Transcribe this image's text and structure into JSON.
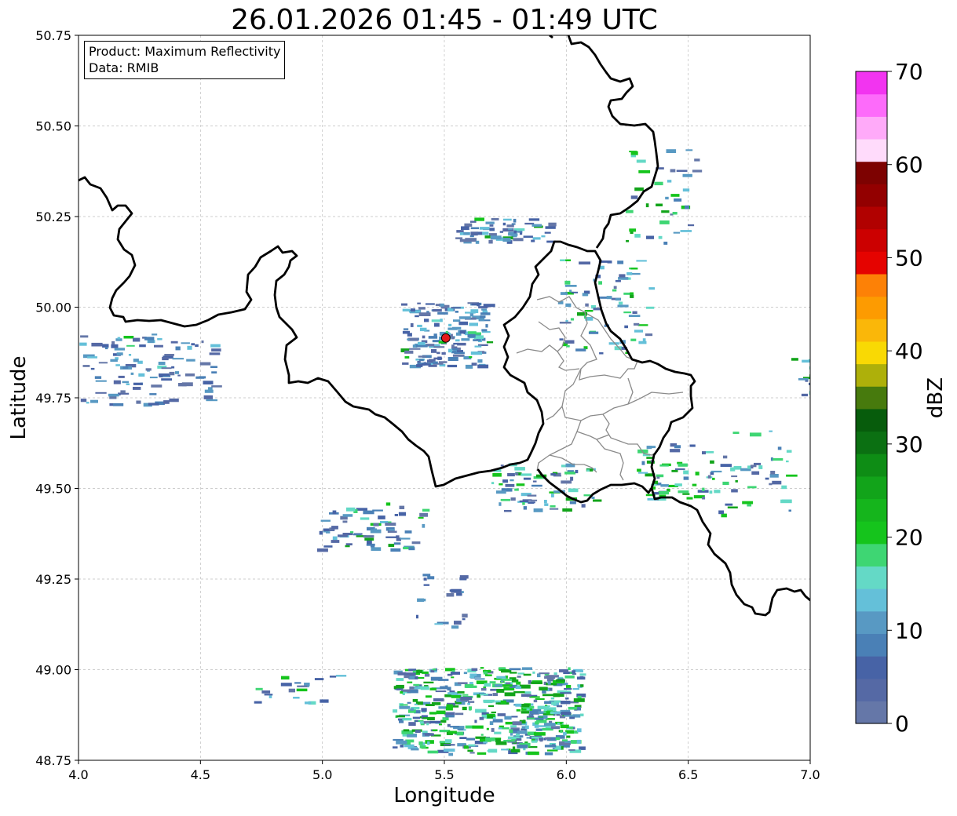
{
  "title": "26.01.2026 01:45 - 01:49 UTC",
  "info_box": {
    "line1": "Product: Maximum Reflectivity",
    "line2": "Data: RMIB"
  },
  "xaxis": {
    "label": "Longitude",
    "range": [
      4.0,
      7.0
    ],
    "ticks": [
      "4.0",
      "4.5",
      "5.0",
      "5.5",
      "6.0",
      "6.5",
      "7.0"
    ]
  },
  "yaxis": {
    "label": "Latitude",
    "range": [
      48.75,
      50.75
    ],
    "ticks": [
      "48.75",
      "49.00",
      "49.25",
      "49.50",
      "49.75",
      "50.00",
      "50.25",
      "50.50",
      "50.75"
    ]
  },
  "grid": true,
  "radar_site": {
    "lon": 5.506,
    "lat": 49.915,
    "color": "#e41a1c"
  },
  "colorbar": {
    "label": "dBZ",
    "range": [
      0,
      70
    ],
    "tick_labels": [
      "0",
      "10",
      "20",
      "30",
      "40",
      "50",
      "60",
      "70"
    ],
    "colors": [
      "#6577a8",
      "#5569a5",
      "#4763a6",
      "#4a80b6",
      "#5899c3",
      "#64c0d9",
      "#64d9c6",
      "#3ed673",
      "#15c41c",
      "#15b51c",
      "#12a41a",
      "#0e8d15",
      "#0b7012",
      "#075c0c",
      "#477a0d",
      "#aeb00a",
      "#f9d904",
      "#fab709",
      "#fd9b01",
      "#fd8106",
      "#e50300",
      "#cc0000",
      "#b10100",
      "#930000",
      "#7d0201",
      "#ffdbfb",
      "#ffaaf9",
      "#fd6bfa",
      "#f234f0"
    ]
  }
}
